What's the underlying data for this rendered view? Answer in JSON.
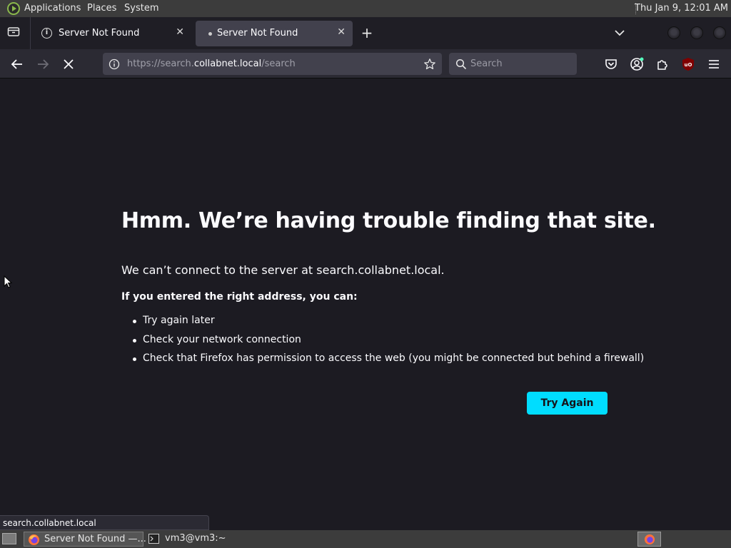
{
  "system_panel": {
    "menus": [
      "Applications",
      "Places",
      "System"
    ],
    "clock": "Thu Jan  9, 12:01 AM"
  },
  "tabs": [
    {
      "title": "Server Not Found",
      "close": "✕"
    },
    {
      "title": "Server Not Found",
      "close": "✕"
    }
  ],
  "new_tab_label": "+",
  "toolbar": {
    "url_prefix": "https://search.",
    "url_host": "collabnet.local",
    "url_path": "/search",
    "search_placeholder": "Search"
  },
  "error_page": {
    "title": "Hmm. We’re having trouble finding that site.",
    "description": "We can’t connect to the server at search.collabnet.local.",
    "subheading": "If you entered the right address, you can:",
    "suggestions": [
      "Try again later",
      "Check your network connection",
      "Check that Firefox has permission to access the web (you might be connected but behind a firewall)"
    ],
    "try_again_label": "Try Again"
  },
  "status_bar_text": "search.collabnet.local",
  "taskbar": {
    "items": [
      "Server Not Found —...",
      "vm3@vm3:~"
    ]
  },
  "colors": {
    "page_background": "#1c1b22",
    "accent_button": "#00ddff",
    "toolbar": "#2b2a33",
    "panel": "#3c3c3c"
  },
  "icons": [
    "tab-list-icon",
    "info-icon",
    "back-icon",
    "forward-icon",
    "stop-icon",
    "bookmark-star-icon",
    "search-icon",
    "pocket-icon",
    "account-icon",
    "extensions-icon",
    "ublock-icon",
    "hamburger-menu-icon",
    "firefox-icon",
    "terminal-icon"
  ]
}
